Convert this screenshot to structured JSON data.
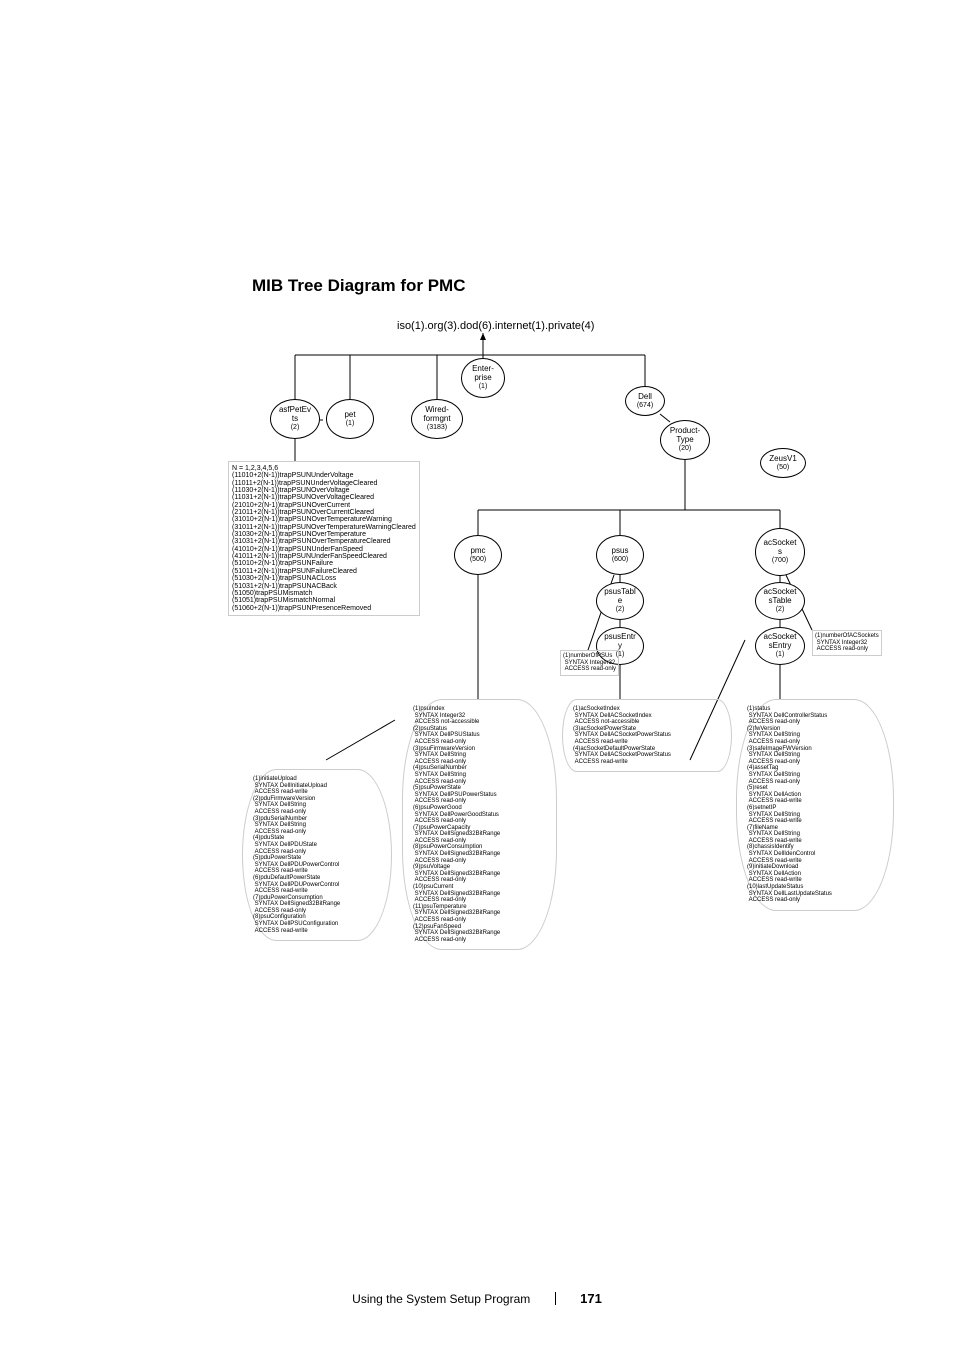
{
  "heading": "MIB Tree Diagram for PMC",
  "oidroot": "iso(1).org(3).dod(6).internet(1).private(4)",
  "nodes": {
    "enterprise": {
      "name": "Enter-\nprise",
      "id": "(1)"
    },
    "asfPetEvts": {
      "name": "asfPetEv\nts",
      "id": "(2)"
    },
    "pet": {
      "name": "pet",
      "id": "(1)"
    },
    "wiredformgnt": {
      "name": "Wired-\nformgnt",
      "id": "(3183)"
    },
    "dell": {
      "name": "Dell",
      "id": "(674)"
    },
    "productType": {
      "name": "Product-\nType",
      "id": "(20)"
    },
    "zeusV1": {
      "name": "ZeusV1",
      "id": "(50)"
    },
    "pmc": {
      "name": "pmc",
      "id": "(500)"
    },
    "psus": {
      "name": "psus",
      "id": "(600)"
    },
    "acSockets": {
      "name": "acSocket\ns",
      "id": "(700)"
    },
    "psusTable": {
      "name": "psusTabl\ne",
      "id": "(2)"
    },
    "acSocketsTable": {
      "name": "acSocket\nsTable",
      "id": "(2)"
    },
    "psusEntry": {
      "name": "psusEntr\ny",
      "id": "(1)"
    },
    "acSocketsEntry": {
      "name": "acSocket\nsEntry",
      "id": "(1)"
    }
  },
  "trapHeader": "N = 1,2,3,4,5,6",
  "traps": [
    "(11010+2(N-1))trapPSUNUnderVoltage",
    "(11011+2(N-1))trapPSUNUnderVoltageCleared",
    "(11030+2(N-1))trapPSUNOverVoltage",
    "(11031+2(N-1))trapPSUNOverVoltageCleared",
    "(21010+2(N-1))trapPSUNOverCurrent",
    "(21011+2(N-1))trapPSUNOverCurrentCleared",
    "(31010+2(N-1))trapPSUNOverTemperatureWarning",
    "(31011+2(N-1))trapPSUNOverTemperatureWarningCleared",
    "(31030+2(N-1))trapPSUNOverTemperature",
    "(31031+2(N-1))trapPSUNOverTemperatureCleared",
    "(41010+2(N-1))trapPSUNUnderFanSpeed",
    "(41011+2(N-1))trapPSUNUnderFanSpeedCleared",
    "(51010+2(N-1))trapPSUNFailure",
    "(51011+2(N-1))trapPSUNFailureCleared",
    "(51030+2(N-1))trapPSUNACLoss",
    "(51031+2(N-1))trapPSUNACBack",
    "(51050)trapPSUMismatch",
    "(51051)trapPSUMismatchNormal",
    "(51060+2(N-1))trapPSUNPresenceRemoved"
  ],
  "numberOfPSUs": "(1)numberOfPSUs\n SYNTAX Integer32\n ACCESS read-only",
  "numberOfACSockets": "(1)numberOfACSockets\n SYNTAX Integer32\n ACCESS read-only",
  "leafBox_pmc": "(1)initiateUpload\n SYNTAX DellInitiateUpload\n ACCESS read-write\n(2)pduFirmwareVersion\n SYNTAX DellString\n ACCESS read-only\n(3)pduSerialNumber\n SYNTAX DellString\n ACCESS read-only\n(4)pduState\n SYNTAX DellPDUState\n ACCESS read-only\n(5)pduPowerState\n SYNTAX DellPDUPowerControl\n ACCESS read-write\n(6)pduDefaultPowerState\n SYNTAX DellPDUPowerControl\n ACCESS read-write\n(7)pduPowerConsumption\n SYNTAX DellSigned32BitRange\n ACCESS read-only\n(8)psuConfiguration\n SYNTAX DellPSUConfiguration\n ACCESS read-write",
  "leafBox_psus": "(1)psuIndex\n SYNTAX Integer32\n ACCESS not-accessible\n(2)psuStatus\n SYNTAX DellPSUStatus\n ACCESS read-only\n(3)psuFirmwareVersion\n SYNTAX DellString\n ACCESS read-only\n(4)psuSerialNumber\n SYNTAX DellString\n ACCESS read-only\n(5)psuPowerState\n SYNTAX DellPSUPowerStatus\n ACCESS read-only\n(6)psuPowerGood\n SYNTAX DellPowerGoodStatus\n ACCESS read-only\n(7)psuPowerCapacity\n SYNTAX DellSigned32BitRange\n ACCESS read-only\n(8)psuPowerConsumption\n SYNTAX DellSigned32BitRange\n ACCESS read-only\n(9)psuVoltage\n SYNTAX DellSigned32BitRange\n ACCESS read-only\n(10)psuCurrent\n SYNTAX DellSigned32BitRange\n ACCESS read-only\n(11)psuTemperature\n SYNTAX DellSigned32BitRange\n ACCESS read-only\n(12)psuFanSpeed\n SYNTAX DellSigned32BitRange\n ACCESS read-only",
  "leafBox_acSockets": "(1)acSocketIndex\n SYNTAX DellACSocketIndex\n ACCESS not-accessible\n(3)acSocketPowerState\n SYNTAX DellACSocketPowerStatus\n ACCESS read-write\n(4)acSocketDefaultPowerState\n SYNTAX DellACSocketPowerStatus\n ACCESS read-write",
  "leafBox_status": "(1)status\n SYNTAX DellControllerStatus\n ACCESS read-only\n(2)fwVersion\n SYNTAX DellString\n ACCESS read-only\n(3)safeImageFWVersion\n SYNTAX DellString\n ACCESS read-only\n(4)assetTag\n SYNTAX DellString\n ACCESS read-only\n(5)reset\n SYNTAX DellAction\n ACCESS read-write\n(6)setnetIP\n SYNTAX DellString\n ACCESS read-write\n(7)fileName\n SYNTAX DellString\n ACCESS read-write\n(8)chassisIdentify\n SYNTAX DellIdenControl\n ACCESS read-write\n(9)initiateDownload\n SYNTAX DellAction\n ACCESS read-write\n(10)lastUpdateStatus\n SYNTAX DellLastUpdateStatus\n ACCESS read-only",
  "footer": {
    "section": "Using the System Setup Program",
    "page": "171"
  }
}
